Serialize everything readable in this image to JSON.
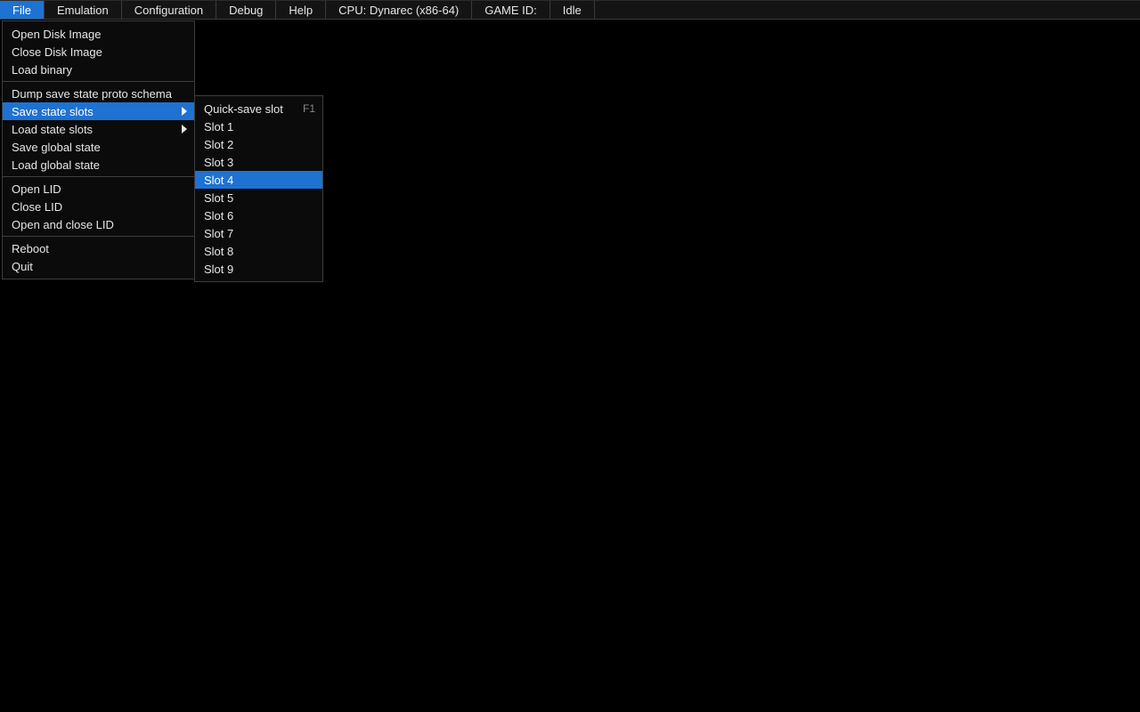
{
  "menubar": {
    "file": "File",
    "emulation": "Emulation",
    "configuration": "Configuration",
    "debug": "Debug",
    "help": "Help",
    "cpu": "CPU: Dynarec (x86-64)",
    "game_id": "GAME ID:",
    "state": "Idle"
  },
  "file_menu": {
    "open_disk_image": "Open Disk Image",
    "close_disk_image": "Close Disk Image",
    "load_binary": "Load binary",
    "dump_schema": "Dump save state proto schema",
    "save_state_slots": "Save state slots",
    "load_state_slots": "Load state slots",
    "save_global": "Save global state",
    "load_global": "Load global state",
    "open_lid": "Open LID",
    "close_lid": "Close LID",
    "open_close_lid": "Open and close LID",
    "reboot": "Reboot",
    "quit": "Quit"
  },
  "slot_menu": {
    "quick": {
      "label": "Quick-save slot",
      "accel": "F1"
    },
    "s1": "Slot 1",
    "s2": "Slot 2",
    "s3": "Slot 3",
    "s4": "Slot 4",
    "s5": "Slot 5",
    "s6": "Slot 6",
    "s7": "Slot 7",
    "s8": "Slot 8",
    "s9": "Slot 9"
  }
}
